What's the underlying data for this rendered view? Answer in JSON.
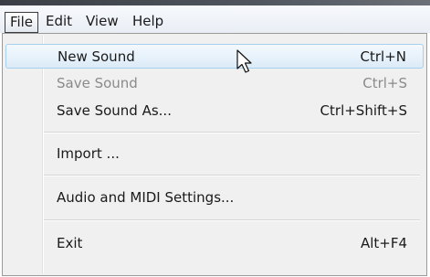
{
  "menubar": {
    "items": [
      {
        "label": "File",
        "active": true
      },
      {
        "label": "Edit",
        "active": false
      },
      {
        "label": "View",
        "active": false
      },
      {
        "label": "Help",
        "active": false
      }
    ]
  },
  "file_menu": {
    "items": [
      {
        "label": "New Sound",
        "shortcut": "Ctrl+N",
        "enabled": true,
        "highlighted": true
      },
      {
        "label": "Save Sound",
        "shortcut": "Ctrl+S",
        "enabled": false,
        "highlighted": false
      },
      {
        "label": "Save Sound As...",
        "shortcut": "Ctrl+Shift+S",
        "enabled": true,
        "highlighted": false
      },
      {
        "label": "Import ...",
        "shortcut": "",
        "enabled": true,
        "highlighted": false
      },
      {
        "label": "Audio and MIDI Settings...",
        "shortcut": "",
        "enabled": true,
        "highlighted": false
      },
      {
        "label": "Exit",
        "shortcut": "Alt+F4",
        "enabled": true,
        "highlighted": false
      }
    ]
  },
  "icons": {
    "cursor": "mouse-pointer-icon"
  },
  "colors": {
    "highlight_border": "#a7cfee",
    "highlight_fill": "#dcebf8",
    "disabled_text": "#8a8a8a",
    "menu_background": "#f0f0f0"
  }
}
